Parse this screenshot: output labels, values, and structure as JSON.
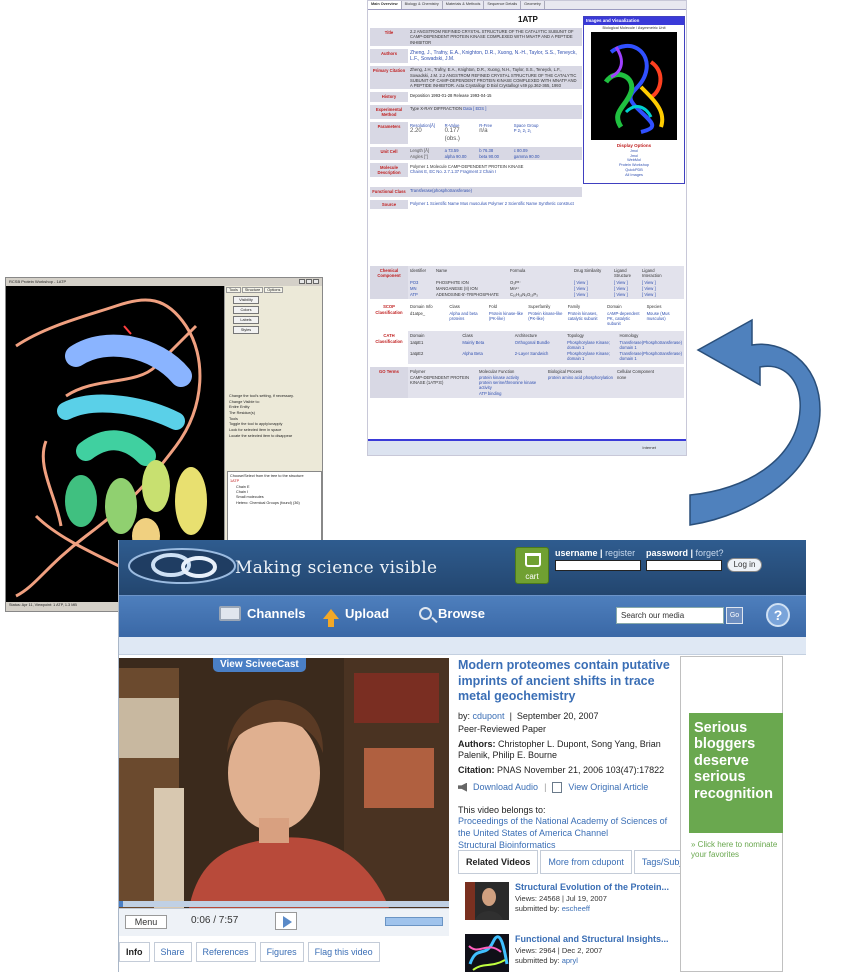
{
  "pdb": {
    "tabs": [
      "Main Overview",
      "Biology & Chemistry",
      "Materials & Methods",
      "Sequence Details",
      "Geometry"
    ],
    "id": "1ATP",
    "rows": {
      "title_label": "Title",
      "title_value": "2.2 ANGSTROM REFINED CRYSTAL STRUCTURE OF THE CATALYTIC SUBUNIT OF CAMP-DEPENDENT PROTEIN KINASE COMPLEXED WITH MNATP AND A PEPTIDE INHIBITOR",
      "authors_label": "Authors",
      "authors_value": "Zheng, J., Trafny, E.A., Knighton, D.R., Xuong, N.-H., Taylor, S.S., Teneyck, L.F., Sowadski, J.M.",
      "citation_label": "Primary Citation",
      "citation_value": "Zheng, J.H., Trafny, E.A., Knighton, D.R., Xuong, N.H., Taylor, S.S., Teneyck, L.F., Sowadski, J.M. 2.2 ANGSTROM REFINED CRYSTAL STRUCTURE OF THE CATALYTIC SUBUNIT OF CAMP-DEPENDENT PROTEIN KINASE COMPLEXED WITH MNATP AND A PEPTIDE INHIBITOR. Acta Crystallogr D Biol Crystallogr v49 pp.362-365, 1993",
      "history_label": "History",
      "history_value": "Deposition 1993-01-28 Release 1993-04-15",
      "method_label": "Experimental Method",
      "method_value": "Type X-RAY DIFFRACTION",
      "method_links": "Data [ EDS ]",
      "params_label": "Parameters",
      "params_heads": [
        "Resolution[Å]",
        "R-Value",
        "R-Free",
        "Space Group",
        ""
      ],
      "params_vals": [
        "2.20",
        "0.177 (obs.)",
        "n/a",
        "P 2₁ 2₁ 2₁",
        ""
      ],
      "unitcell_label": "Unit Cell",
      "unitcell_row1": [
        "Length [Å]",
        "a 73.59",
        "b 76.38",
        "c 80.09",
        ""
      ],
      "unitcell_row2": [
        "Angles [°]",
        "alpha 90.00",
        "beta 90.00",
        "gamma 90.00",
        ""
      ],
      "molecule_label": "Molecule Description",
      "molecule_line1": "Polymer 1 Molecule CAMP-DEPENDENT PROTEIN KINASE",
      "molecule_line2": "Chains E, EC No. 2.7.1.37 Fragment 2 Chain I",
      "functional_label": "Functional Class",
      "functional_value": "Transferase(phosphotransferase)",
      "source_label": "Source",
      "source_value": "Polymer 1 Scientific Name Mus musculus   Polymer 2 Scientific Name Synthetic construct"
    },
    "images": {
      "header": "Images and Visualization",
      "sub": "Biological Molecule / Asymmetric Unit",
      "options_title": "Display Options",
      "options": [
        "Jmol",
        "Jmol",
        "WebMol",
        "Protein Workshop",
        "QuickPDB",
        "All Images"
      ]
    },
    "lower": {
      "chem_label": "Chemical Component",
      "chem_heads": [
        "Identifier",
        "Name",
        "Formula",
        "Drug Similarity",
        "Ligand Structure",
        "Ligand Interaction"
      ],
      "chem_rows": [
        [
          "PO3",
          "PHOSPHITE ION",
          "O₃P³⁻",
          "[ View ]",
          "[ View ]",
          "[ View ]"
        ],
        [
          "MN",
          "MANGANESE (II) ION",
          "Mn²⁺",
          "[ View ]",
          "[ View ]",
          "[ View ]"
        ],
        [
          "ATP",
          "ADENOSINE-5'-TRIPHOSPHATE",
          "C₁₀H₁₆N₅O₁₃P₃",
          "[ View ]",
          "[ View ]",
          "[ View ]"
        ]
      ],
      "scop_label": "SCOP Classification",
      "scop_heads": [
        "Domain Info",
        "Class",
        "Fold",
        "Superfamily",
        "Family",
        "Domain",
        "Species"
      ],
      "scop_row": [
        "d1atpe_",
        "Alpha and beta proteins",
        "Protein kinase-like (PK-like)",
        "Protein kinase-like (PK-like)",
        "Protein kinases, catalytic subunit",
        "cAMP-dependent PK, catalytic subunit",
        "Mouse (Mus musculus)"
      ],
      "cath_label": "CATH Classification",
      "cath_heads": [
        "Domain",
        "Class",
        "Architecture",
        "Topology",
        "Homology"
      ],
      "cath_rows": [
        [
          "1atpE1",
          "Mainly Beta",
          "Orthogonal Bundle",
          "Phosphorylase Kinase; domain 1",
          "Transferase(Phosphotransferase) domain 1"
        ],
        [
          "1atpE2",
          "Alpha Beta",
          "2-Layer Sandwich",
          "Phosphorylase Kinase; domain 1",
          "Transferase(Phosphotransferase) domain 1"
        ]
      ],
      "go_label": "GO Terms",
      "go_heads": [
        "Polymer",
        "Molecular Function",
        "Biological Process",
        "Cellular Component"
      ],
      "go_polymer": "CAMP-DEPENDENT PROTEIN KINASE (1ATP:E)",
      "go_functions": [
        "protein kinase activity",
        "protein serine/threonine kinase activity",
        "ATP binding"
      ],
      "go_process": [
        "protein amino acid phosphorylation"
      ],
      "go_component": [
        "none"
      ]
    },
    "status": "Internet"
  },
  "workshop": {
    "title": "RCSB Protein Workshop - 1ATP",
    "tabs": [
      "Tools",
      "Structure",
      "Options"
    ],
    "tool_buttons": [
      "Visibility",
      "Colors",
      "Labels",
      "Styles"
    ],
    "options_lines": [
      "Change the tool's setting, if necessary.",
      "Change Visible to:",
      "Entire Entity",
      "The Residue(s)",
      "Tools",
      "Toggle the tool to apply/unapply",
      "Look for selected item in space",
      "Locate the selected item to disappear"
    ],
    "tree_header": "Choose/Select from the tree to the structure",
    "tree": [
      "1ATP",
      "Chain E",
      "Chain I",
      "Small molecules",
      "Hetero: Chemical Groups (found) (36)"
    ],
    "status": "Status: Apr 11, Viewpoint: 1 ATP, 1.3 MB"
  },
  "scivee": {
    "tagline": "Making science visible",
    "cart_label": "cart",
    "username_label": "username",
    "register_link": "register",
    "password_label": "password",
    "forget_link": "forget?",
    "login_button": "Log in",
    "nav": {
      "channels": "Channels",
      "upload": "Upload",
      "browse": "Browse"
    },
    "search_placeholder": "Search our media",
    "go_label": "Go",
    "help_label": "?",
    "video": {
      "tag": "View SciveeCast",
      "menu": "Menu",
      "time": "0:06 / 7:57",
      "progress": 0.013
    },
    "info_tabs": [
      "Info",
      "Share",
      "References",
      "Figures",
      "Flag this video"
    ],
    "title": "Modern proteomes contain putative imprints of ancient shifts in trace metal geochemistry",
    "by_prefix": "by:",
    "by_user": "cdupont",
    "date": "September 20, 2007",
    "paper_type": "Peer-Reviewed Paper",
    "authors_label": "Authors:",
    "authors": "Christopher L. Dupont, Song Yang, Brian Palenik, Philip E. Bourne",
    "citation_label": "Citation:",
    "citation": "PNAS November 21, 2006 103(47):17822",
    "download_audio": "Download Audio",
    "view_article": "View Original Article",
    "belongs_label": "This video belongs to:",
    "belongs_links": [
      "Proceedings of the National Academy of Sciences of the United States of America Channel",
      "Structural Bioinformatics"
    ],
    "related_tabs": [
      "Related Videos",
      "More from cdupont",
      "Tags/Subj"
    ],
    "related": [
      {
        "title": "Structural Evolution of the Protein...",
        "views": "Views: 24568 | Jul 19, 2007",
        "submitted": "submitted by:",
        "user": "escheeff"
      },
      {
        "title": "Functional and Structural Insights...",
        "views": "Views: 2964 | Dec 2, 2007",
        "submitted": "submitted by:",
        "user": "apryl"
      }
    ],
    "ad_text": "Serious bloggers deserve serious recognition",
    "ad_link": "» Click here to nominate your favorites"
  },
  "colors": {
    "scivee_header": "#2f5c8f",
    "scivee_nav": "#3a68a6",
    "link_blue": "#3a6eb5",
    "ad_green": "#6aa84f",
    "arrow_blue": "#4f81bd",
    "pdb_red": "#c02020"
  }
}
